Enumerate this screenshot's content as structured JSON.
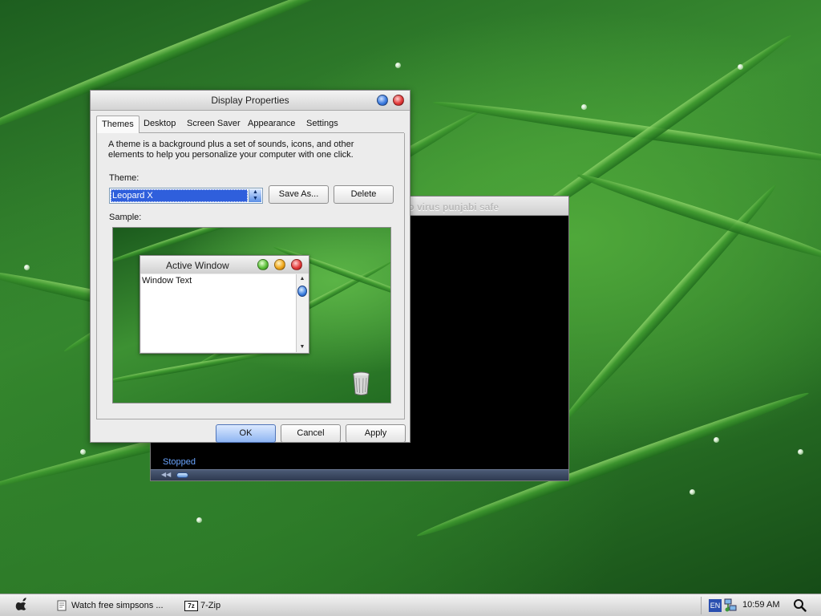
{
  "player": {
    "title": "lo virus punjabi safe",
    "status": "Stopped"
  },
  "dialog": {
    "title": "Display Properties",
    "tabs": [
      "Themes",
      "Desktop",
      "Screen Saver",
      "Appearance",
      "Settings"
    ],
    "active_tab": "Themes",
    "description": "A theme is a background plus a set of sounds, icons, and other elements to help you personalize your computer with one click.",
    "theme_label": "Theme:",
    "theme_value": "Leopard X",
    "save_as_label": "Save As...",
    "delete_label": "Delete",
    "sample_label": "Sample:",
    "sample_window": {
      "title": "Active Window",
      "text": "Window Text"
    },
    "ok_label": "OK",
    "cancel_label": "Cancel",
    "apply_label": "Apply"
  },
  "taskbar": {
    "tasks": [
      "Watch free simpsons ...",
      "7-Zip"
    ],
    "zip_icon_text": "7z",
    "language": "EN",
    "clock": "10:59 AM"
  },
  "icons": {
    "help": "help-icon",
    "close": "close-icon",
    "apple": "apple-icon",
    "recycle_bin": "recycle-bin-icon",
    "network": "network-icon",
    "search": "search-icon"
  },
  "colors": {
    "selection": "#2f5fdc",
    "primary_button": "#8fb5f2",
    "status_text": "#6aa5ff"
  }
}
